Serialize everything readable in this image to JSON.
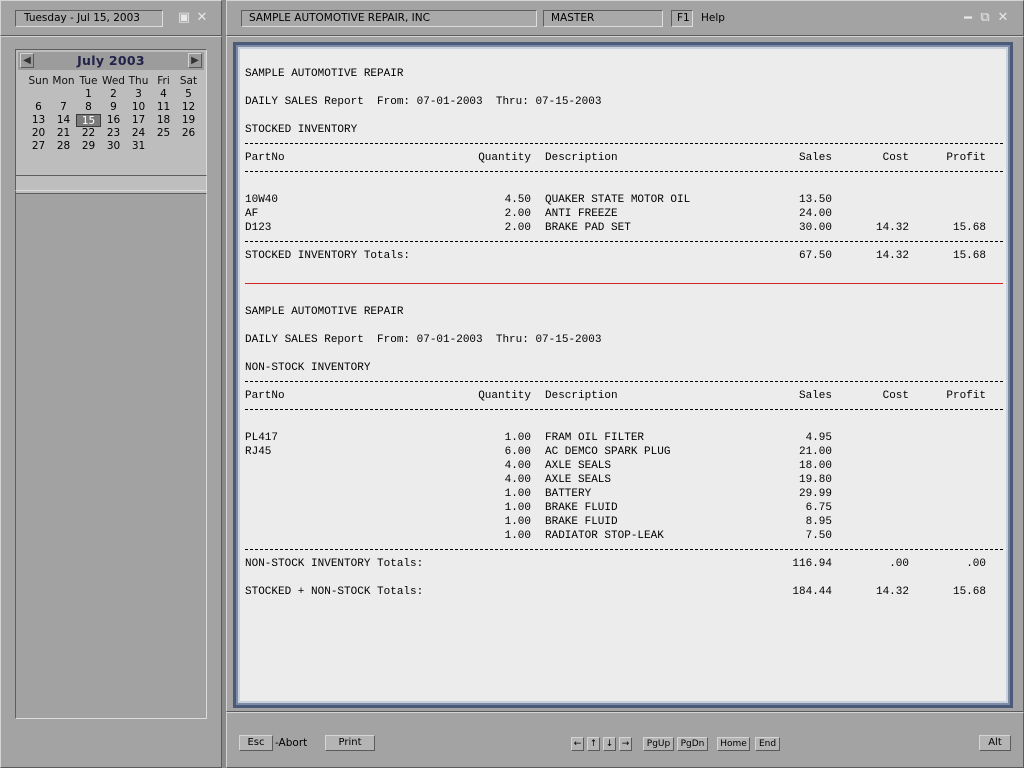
{
  "left": {
    "date_label": "Tuesday - Jul 15, 2003",
    "calendar": {
      "title": "July  2003",
      "prev_icon": "left-triangle-icon",
      "next_icon": "right-triangle-icon",
      "dows": [
        "Sun",
        "Mon",
        "Tue",
        "Wed",
        "Thu",
        "Fri",
        "Sat"
      ],
      "weeks": [
        [
          "",
          "",
          "1",
          "2",
          "3",
          "4",
          "5"
        ],
        [
          "6",
          "7",
          "8",
          "9",
          "10",
          "11",
          "12"
        ],
        [
          "13",
          "14",
          "15",
          "16",
          "17",
          "18",
          "19"
        ],
        [
          "20",
          "21",
          "22",
          "23",
          "24",
          "25",
          "26"
        ],
        [
          "27",
          "28",
          "29",
          "30",
          "31",
          "",
          ""
        ]
      ],
      "selected": "15"
    }
  },
  "titlebar": {
    "company": "SAMPLE AUTOMOTIVE REPAIR, INC",
    "mode": "MASTER",
    "help_key": "F1",
    "help_label": "Help"
  },
  "report": {
    "sections": [
      {
        "company": "SAMPLE AUTOMOTIVE REPAIR",
        "subtitle": "DAILY SALES Report  From: 07-01-2003  Thru: 07-15-2003",
        "category": "STOCKED INVENTORY",
        "headers": {
          "partno": "PartNo",
          "qty": "Quantity",
          "desc": "Description",
          "sales": "Sales",
          "cost": "Cost",
          "profit": "Profit"
        },
        "rows": [
          {
            "partno": "10W40",
            "qty": "4.50",
            "desc": "QUAKER STATE MOTOR OIL",
            "sales": "13.50",
            "cost": "",
            "profit": ""
          },
          {
            "partno": "AF",
            "qty": "2.00",
            "desc": "ANTI FREEZE",
            "sales": "24.00",
            "cost": "",
            "profit": ""
          },
          {
            "partno": "D123",
            "qty": "2.00",
            "desc": "BRAKE PAD SET",
            "sales": "30.00",
            "cost": "14.32",
            "profit": "15.68"
          }
        ],
        "totals": [
          {
            "label": "STOCKED INVENTORY Totals:",
            "sales": "67.50",
            "cost": "14.32",
            "profit": "15.68"
          }
        ]
      },
      {
        "company": "SAMPLE AUTOMOTIVE REPAIR",
        "subtitle": "DAILY SALES Report  From: 07-01-2003  Thru: 07-15-2003",
        "category": "NON-STOCK INVENTORY",
        "headers": {
          "partno": "PartNo",
          "qty": "Quantity",
          "desc": "Description",
          "sales": "Sales",
          "cost": "Cost",
          "profit": "Profit"
        },
        "rows": [
          {
            "partno": "PL417",
            "qty": "1.00",
            "desc": "FRAM OIL FILTER",
            "sales": "4.95",
            "cost": "",
            "profit": ""
          },
          {
            "partno": "RJ45",
            "qty": "6.00",
            "desc": "AC DEMCO SPARK PLUG",
            "sales": "21.00",
            "cost": "",
            "profit": ""
          },
          {
            "partno": "",
            "qty": "4.00",
            "desc": "AXLE SEALS",
            "sales": "18.00",
            "cost": "",
            "profit": ""
          },
          {
            "partno": "",
            "qty": "4.00",
            "desc": "AXLE SEALS",
            "sales": "19.80",
            "cost": "",
            "profit": ""
          },
          {
            "partno": "",
            "qty": "1.00",
            "desc": "BATTERY",
            "sales": "29.99",
            "cost": "",
            "profit": ""
          },
          {
            "partno": "",
            "qty": "1.00",
            "desc": "BRAKE FLUID",
            "sales": "6.75",
            "cost": "",
            "profit": ""
          },
          {
            "partno": "",
            "qty": "1.00",
            "desc": "BRAKE FLUID",
            "sales": "8.95",
            "cost": "",
            "profit": ""
          },
          {
            "partno": "",
            "qty": "1.00",
            "desc": "RADIATOR STOP-LEAK",
            "sales": "7.50",
            "cost": "",
            "profit": ""
          }
        ],
        "totals": [
          {
            "label": "NON-STOCK INVENTORY Totals:",
            "sales": "116.94",
            "cost": ".00",
            "profit": ".00"
          },
          {
            "label": "STOCKED + NON-STOCK Totals:",
            "sales": "184.44",
            "cost": "14.32",
            "profit": "15.68"
          }
        ]
      }
    ]
  },
  "bottombar": {
    "esc": "Esc",
    "abort": "-Abort",
    "print": "Print",
    "nav_icons": [
      "left-arrow-icon",
      "up-arrow-icon",
      "down-arrow-icon",
      "right-arrow-icon"
    ],
    "pgup": "PgUp",
    "pgdn": "PgDn",
    "home": "Home",
    "end": "End",
    "alt": "Alt"
  }
}
